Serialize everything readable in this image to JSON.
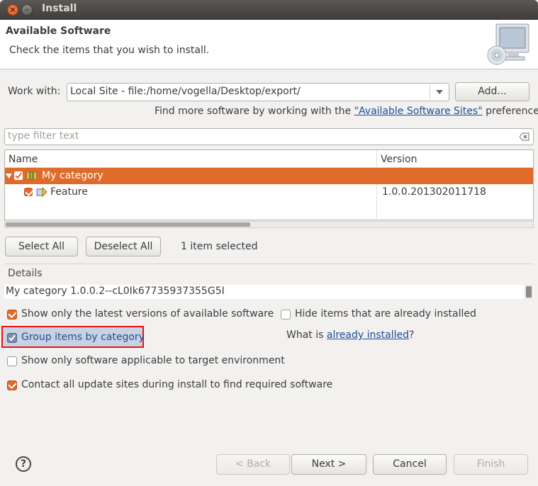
{
  "window": {
    "title": "Install"
  },
  "header": {
    "title": "Available Software",
    "description": "Check the items that you wish to install.",
    "graphic_icon": "monitor-cd-icon"
  },
  "work_with": {
    "label": "Work with:",
    "value": "Local Site - file:/home/vogella/Desktop/export/",
    "add_label": "Add...",
    "find_more_prefix": "Find more software by working with the ",
    "find_more_link": "\"Available Software Sites\"",
    "find_more_suffix": " preferences."
  },
  "filter": {
    "placeholder": "type filter text"
  },
  "tree": {
    "columns": [
      "Name",
      "Version"
    ],
    "rows": [
      {
        "name": "My category",
        "version": "",
        "checked": true,
        "expanded": true,
        "selected": true,
        "icon": "category-icon"
      },
      {
        "name": "Feature",
        "version": "1.0.0.201302011718",
        "checked": true,
        "selected": false,
        "icon": "feature-icon"
      }
    ]
  },
  "selection": {
    "select_all": "Select All",
    "deselect_all": "Deselect All",
    "count_text": "1 item selected"
  },
  "details": {
    "label": "Details",
    "text": "My category 1.0.0.2--cL0Ik67735937355G5I"
  },
  "options": {
    "latest_versions": {
      "label": "Show only the latest versions of available software",
      "checked": true
    },
    "hide_installed": {
      "label": "Hide items that are already installed",
      "checked": false
    },
    "group_by_category": {
      "label": "Group items by category",
      "checked": true
    },
    "what_is_prefix": "What is ",
    "what_is_link": "already installed",
    "what_is_suffix": "?",
    "target_env": {
      "label": "Show only software applicable to target environment",
      "checked": false
    },
    "contact_sites": {
      "label": "Contact all update sites during install to find required software",
      "checked": true
    }
  },
  "footer": {
    "back": "< Back",
    "next": "Next >",
    "cancel": "Cancel",
    "finish": "Finish",
    "help_symbol": "?"
  },
  "colors": {
    "accent": "#e06a2a",
    "link": "#1b4d97",
    "highlight_box": "#e11111",
    "background": "#f2f1f0"
  }
}
